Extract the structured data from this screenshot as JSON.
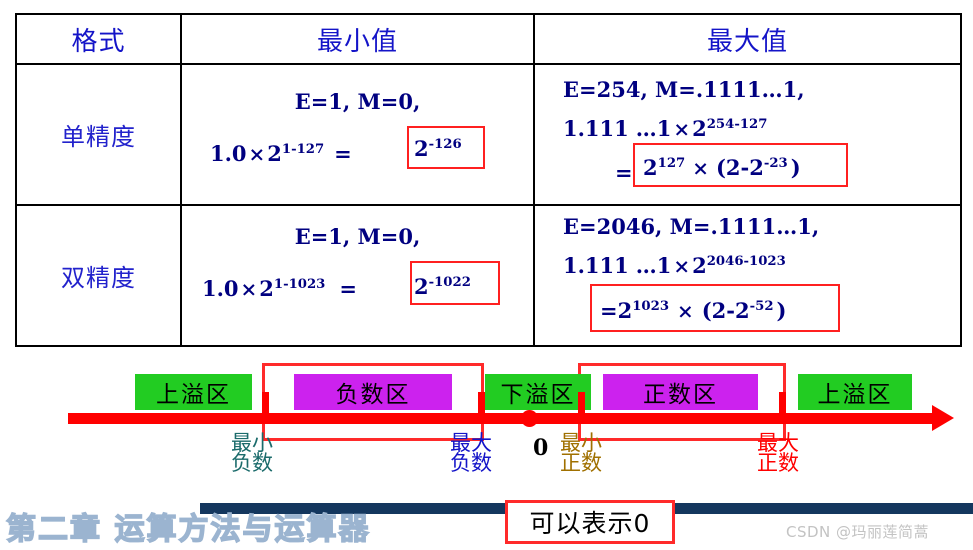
{
  "table": {
    "headers": [
      "格式",
      "最小值",
      "最大值"
    ],
    "rows": [
      {
        "format": "单精度",
        "min": {
          "line1": "E=1, M=0,",
          "line2_lead": "1.0",
          "line2_times": "×",
          "line2_base": "2",
          "line2_exp": "1-127",
          "line2_eq": "=",
          "boxed_base": "2",
          "boxed_exp": "-126"
        },
        "max": {
          "line1": "E=254, M=.1111…1,",
          "line2_lead": "1.111",
          "line2_dots": "…1",
          "line2_times": "×",
          "line2_base": "2",
          "line2_exp": "254-127",
          "line3_eq": "=",
          "line3_base": "2",
          "line3_exp": "127",
          "line3_times": "×",
          "line3_tail_open": "(2-2",
          "line3_tail_exp": "-23",
          "line3_tail_close": ")"
        }
      },
      {
        "format": "双精度",
        "min": {
          "line1": "E=1, M=0,",
          "line2_lead": "1.0",
          "line2_times": "×",
          "line2_base": "2",
          "line2_exp": "1-1023",
          "line2_eq": "=",
          "boxed_base": "2",
          "boxed_exp": "-1022"
        },
        "max": {
          "line1": "E=2046, M=.1111…1,",
          "line2_lead": "1.111",
          "line2_dots": "…1",
          "line2_times": "×",
          "line2_base": "2",
          "line2_exp": "2046-1023",
          "line3_eq": "=",
          "line3_base": "2",
          "line3_exp": "1023",
          "line3_times": "×",
          "line3_tail_open": "(2-2",
          "line3_tail_exp": "-52",
          "line3_tail_close": ")"
        }
      }
    ]
  },
  "numberline": {
    "zones": [
      {
        "label": "上溢区",
        "color": "#22cc22"
      },
      {
        "label": "负数区",
        "color": "#cc22ee"
      },
      {
        "label": "下溢区",
        "color": "#22cc22"
      },
      {
        "label": "正数区",
        "color": "#cc22ee"
      },
      {
        "label": "上溢区",
        "color": "#22cc22"
      }
    ],
    "zero_label": "0",
    "marks": [
      {
        "top": "最小",
        "bottom": "负数",
        "color": "#1b6b6b"
      },
      {
        "top": "最大",
        "bottom": "负数",
        "color": "#1414c8"
      },
      {
        "top": "最小",
        "bottom": "正数",
        "color": "#a07000"
      },
      {
        "top": "最大",
        "bottom": "正数",
        "color": "#ff0000"
      }
    ]
  },
  "footer": {
    "note": "可以表示0",
    "chapter": "第二章 运算方法与运算器",
    "watermark": "CSDN @玛丽莲简蒿"
  },
  "colors": {
    "header_text": "#1414c8",
    "math_text": "#000080",
    "red_box": "#ff2a2a",
    "axis_red": "#ff0000",
    "navy_bar": "#14375e"
  }
}
